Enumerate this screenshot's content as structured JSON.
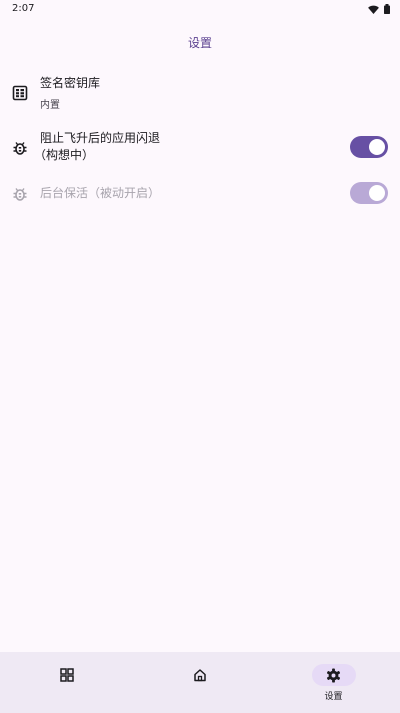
{
  "status_bar": {
    "time": "2:07",
    "wifi_icon": "wifi-icon",
    "battery_icon": "battery-icon"
  },
  "app_bar": {
    "title": "设置"
  },
  "settings": [
    {
      "icon": "keystore-icon",
      "title": "签名密钥库",
      "subtitle": "内置"
    },
    {
      "icon": "bug-icon",
      "title": "阻止飞升后的应用闪退",
      "title_line2": "（构想中）",
      "toggle": "on",
      "enabled": true
    },
    {
      "icon": "bug-icon",
      "title": "后台保活（被动开启）",
      "toggle": "on",
      "enabled": false
    }
  ],
  "bottom_nav": {
    "items": [
      {
        "icon": "grid-icon",
        "label": ""
      },
      {
        "icon": "home-icon",
        "label": ""
      },
      {
        "icon": "gear-icon",
        "label": "设置",
        "active": true
      }
    ]
  },
  "colors": {
    "accent": "#6750a4",
    "accent_disabled": "#b9a9d6",
    "title": "#5a3f8f",
    "background": "#fdf8fd",
    "nav_background": "#efe9f4"
  }
}
